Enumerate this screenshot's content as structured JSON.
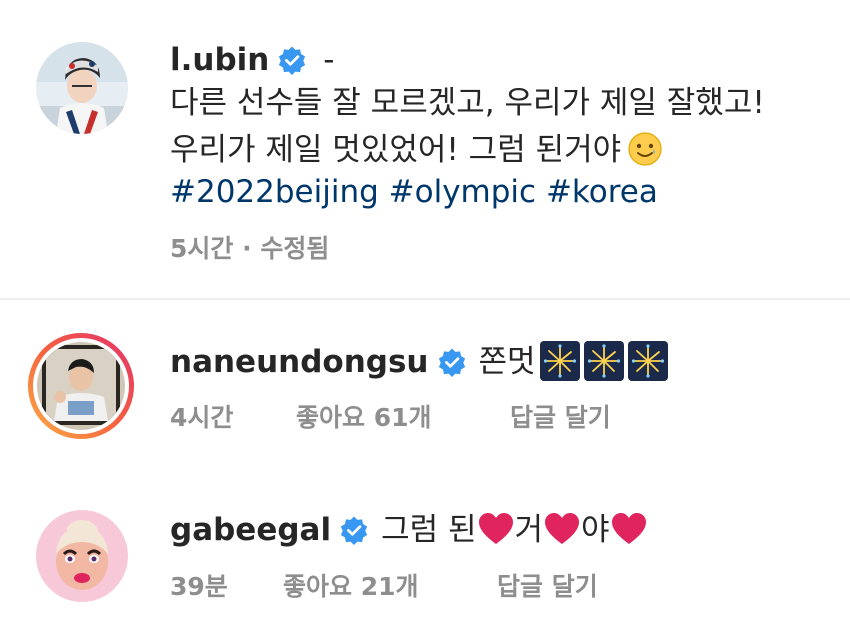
{
  "post": {
    "username": "l.ubin",
    "after_username": " -",
    "caption_line1": "다른 선수들 잘 모르겠고, 우리가 제일 잘했고!",
    "caption_line2": "우리가 제일 멋있었어! 그럼 된거야",
    "caption_emoji": "smiling-face-with-tear",
    "hashtags": [
      "#2022beijing",
      "#olympic",
      "#korea"
    ],
    "time": "5시간",
    "separator": "·",
    "edited": "수정됨"
  },
  "comments": [
    {
      "username": "naneundongsu",
      "text": "쫀멋",
      "emojis": [
        "fireworks",
        "fireworks",
        "fireworks"
      ],
      "time": "4시간",
      "likes": "좋아요 61개",
      "reply": "답글 달기"
    },
    {
      "username": "gabeegal",
      "text_parts": [
        "그럼 된",
        "거",
        "야"
      ],
      "emojis": [
        "red-heart",
        "red-heart",
        "red-heart"
      ],
      "time": "39분",
      "likes": "좋아요 21개",
      "reply": "답글 달기"
    }
  ],
  "colors": {
    "verified": "#3897f0",
    "hashtag": "#00376b",
    "meta": "#8e8e8e",
    "story_ring_start": "#fcaf45",
    "story_ring_end": "#e1306c",
    "heart": "#e0245e"
  }
}
